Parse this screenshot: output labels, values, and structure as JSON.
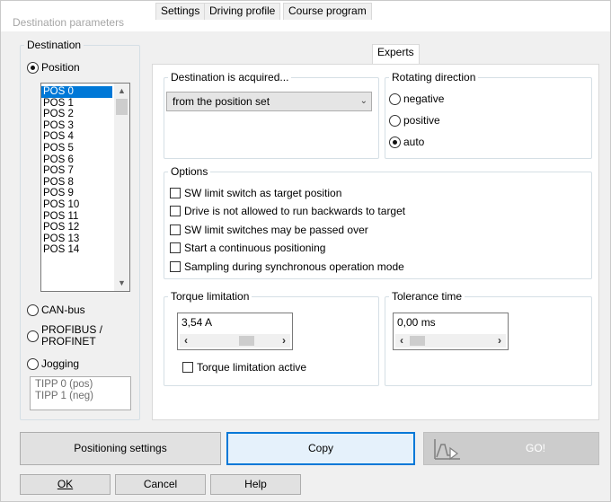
{
  "window": {
    "title": "Destination parameters"
  },
  "destination": {
    "legend": "Destination",
    "position_label": "Position",
    "positions": [
      "POS 0",
      "POS 1",
      "POS 2",
      "POS 3",
      "POS 4",
      "POS 5",
      "POS 6",
      "POS 7",
      "POS 8",
      "POS 9",
      "POS 10",
      "POS 11",
      "POS 12",
      "POS 13",
      "POS 14"
    ],
    "selected_position": "POS 0",
    "canbus_label": "CAN-bus",
    "profibus_label_1": "PROFIBUS /",
    "profibus_label_2": "PROFINET",
    "jogging_label": "Jogging",
    "jog_items": [
      "TIPP 0 (pos)",
      "TIPP 1 (neg)"
    ],
    "selected_source": "Position"
  },
  "tabs": [
    {
      "label": "Settings"
    },
    {
      "label": "Driving profile"
    },
    {
      "label": "Course program"
    },
    {
      "label": "Experts"
    }
  ],
  "active_tab": "Experts",
  "experts": {
    "acquired_legend": "Destination is acquired...",
    "acquired_value": "from the position set",
    "rotating_legend": "Rotating direction",
    "rot_negative": "negative",
    "rot_positive": "positive",
    "rot_auto": "auto",
    "rot_selected": "auto",
    "options_legend": "Options",
    "options": [
      "SW limit switch as target position",
      "Drive is not allowed to run backwards to target",
      "SW limit switches may be passed over",
      "Start a continuous positioning",
      "Sampling during synchronous operation mode"
    ],
    "torque_legend": "Torque limitation",
    "torque_value": "3,54 A",
    "torque_active_label": "Torque limitation active",
    "tolerance_legend": "Tolerance time",
    "tolerance_value": "0,00 ms"
  },
  "buttons": {
    "positioning_settings": "Positioning settings",
    "copy": "Copy",
    "go": "GO!",
    "ok": "OK",
    "cancel": "Cancel",
    "help": "Help"
  },
  "colors": {
    "selection": "#0078d7",
    "copy_border": "#0078d7",
    "go_disabled_bg": "#cccccc"
  }
}
